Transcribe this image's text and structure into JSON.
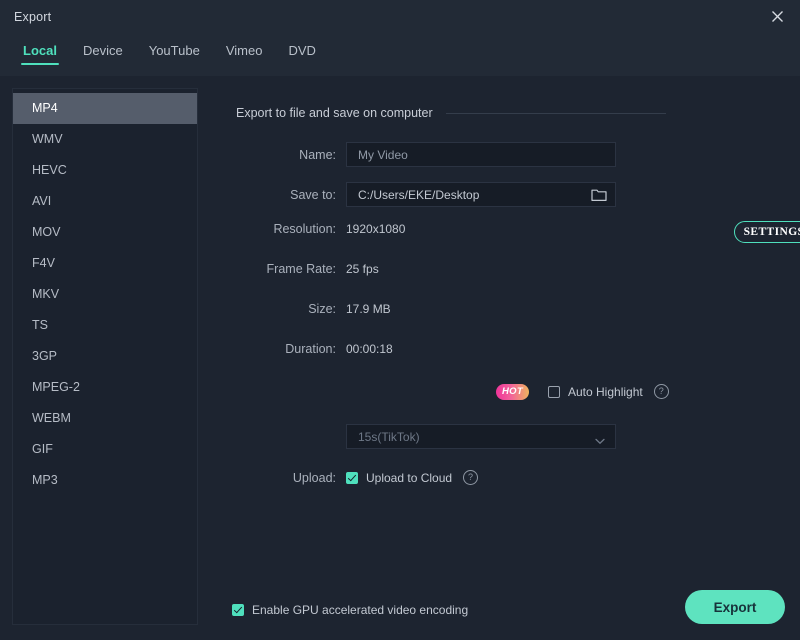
{
  "window": {
    "title": "Export",
    "close_icon": "close-icon"
  },
  "tabs": [
    {
      "label": "Local",
      "active": true
    },
    {
      "label": "Device",
      "active": false
    },
    {
      "label": "YouTube",
      "active": false
    },
    {
      "label": "Vimeo",
      "active": false
    },
    {
      "label": "DVD",
      "active": false
    }
  ],
  "formats": [
    {
      "label": "MP4",
      "selected": true
    },
    {
      "label": "WMV",
      "selected": false
    },
    {
      "label": "HEVC",
      "selected": false
    },
    {
      "label": "AVI",
      "selected": false
    },
    {
      "label": "MOV",
      "selected": false
    },
    {
      "label": "F4V",
      "selected": false
    },
    {
      "label": "MKV",
      "selected": false
    },
    {
      "label": "TS",
      "selected": false
    },
    {
      "label": "3GP",
      "selected": false
    },
    {
      "label": "MPEG-2",
      "selected": false
    },
    {
      "label": "WEBM",
      "selected": false
    },
    {
      "label": "GIF",
      "selected": false
    },
    {
      "label": "MP3",
      "selected": false
    }
  ],
  "main": {
    "section_title": "Export to file and save on computer",
    "name": {
      "label": "Name:",
      "value": "My Video"
    },
    "save_to": {
      "label": "Save to:",
      "value": "C:/Users/EKE/Desktop",
      "browse_icon": "folder-icon"
    },
    "resolution": {
      "label": "Resolution:",
      "value": "1920x1080",
      "settings_button": "SETTINGS"
    },
    "frame_rate": {
      "label": "Frame Rate:",
      "value": "25 fps"
    },
    "size": {
      "label": "Size:",
      "value": "17.9 MB"
    },
    "duration": {
      "label": "Duration:",
      "value": "00:00:18"
    },
    "auto_highlight": {
      "badge": "HOT",
      "label": "Auto Highlight",
      "checked": false,
      "help_icon": "question-mark-icon",
      "help_glyph": "?"
    },
    "highlight_duration": {
      "value": "15s(TikTok)",
      "chevron_icon": "chevron-down-icon"
    },
    "upload": {
      "label": "Upload:",
      "checkbox_label": "Upload to Cloud",
      "checked": true,
      "help_icon": "question-mark-icon",
      "help_glyph": "?"
    }
  },
  "footer": {
    "gpu_label": "Enable GPU accelerated video encoding",
    "gpu_checked": true,
    "export_button": "Export"
  },
  "colors": {
    "accent": "#4fe0bd",
    "export_button": "#5ee3bf",
    "window_bg": "#1d2430",
    "titlebar_bg": "#222a36",
    "sidebar_bg": "#1b222e",
    "selected_item": "#555d6b",
    "field_bg": "#161c26",
    "hot_gradient_start": "#f0349a",
    "hot_gradient_end": "#f0b45e"
  }
}
